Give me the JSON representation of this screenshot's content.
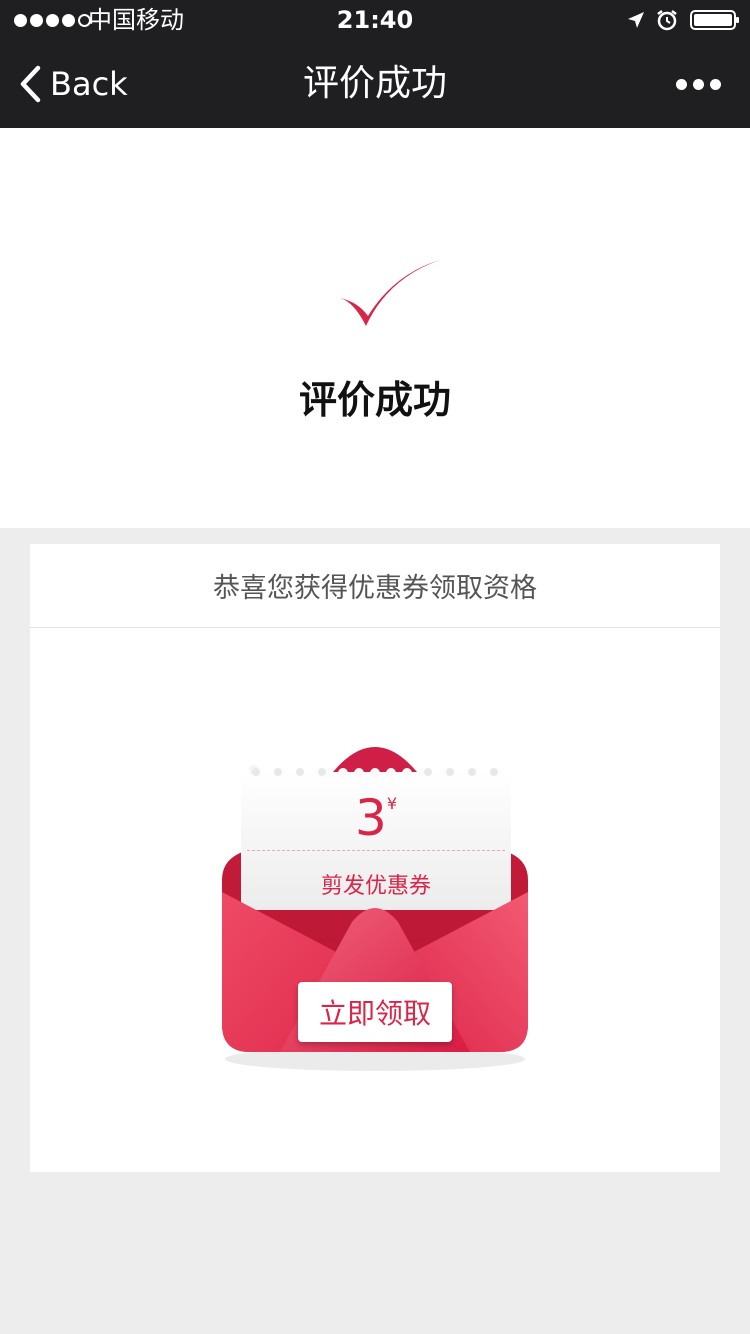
{
  "status_bar": {
    "carrier": "中国移动",
    "time": "21:40",
    "signal_bars": 4,
    "signal_max": 5
  },
  "nav": {
    "back_label": "Back",
    "title": "评价成功"
  },
  "success": {
    "message": "评价成功"
  },
  "coupon": {
    "header": "恭喜您获得优惠券领取资格",
    "amount": "3",
    "currency": "¥",
    "name": "剪发优惠券",
    "claim_label": "立即领取"
  },
  "colors": {
    "accent": "#d8254a",
    "nav_bg": "#1f1f22",
    "page_bg": "#ededed"
  }
}
